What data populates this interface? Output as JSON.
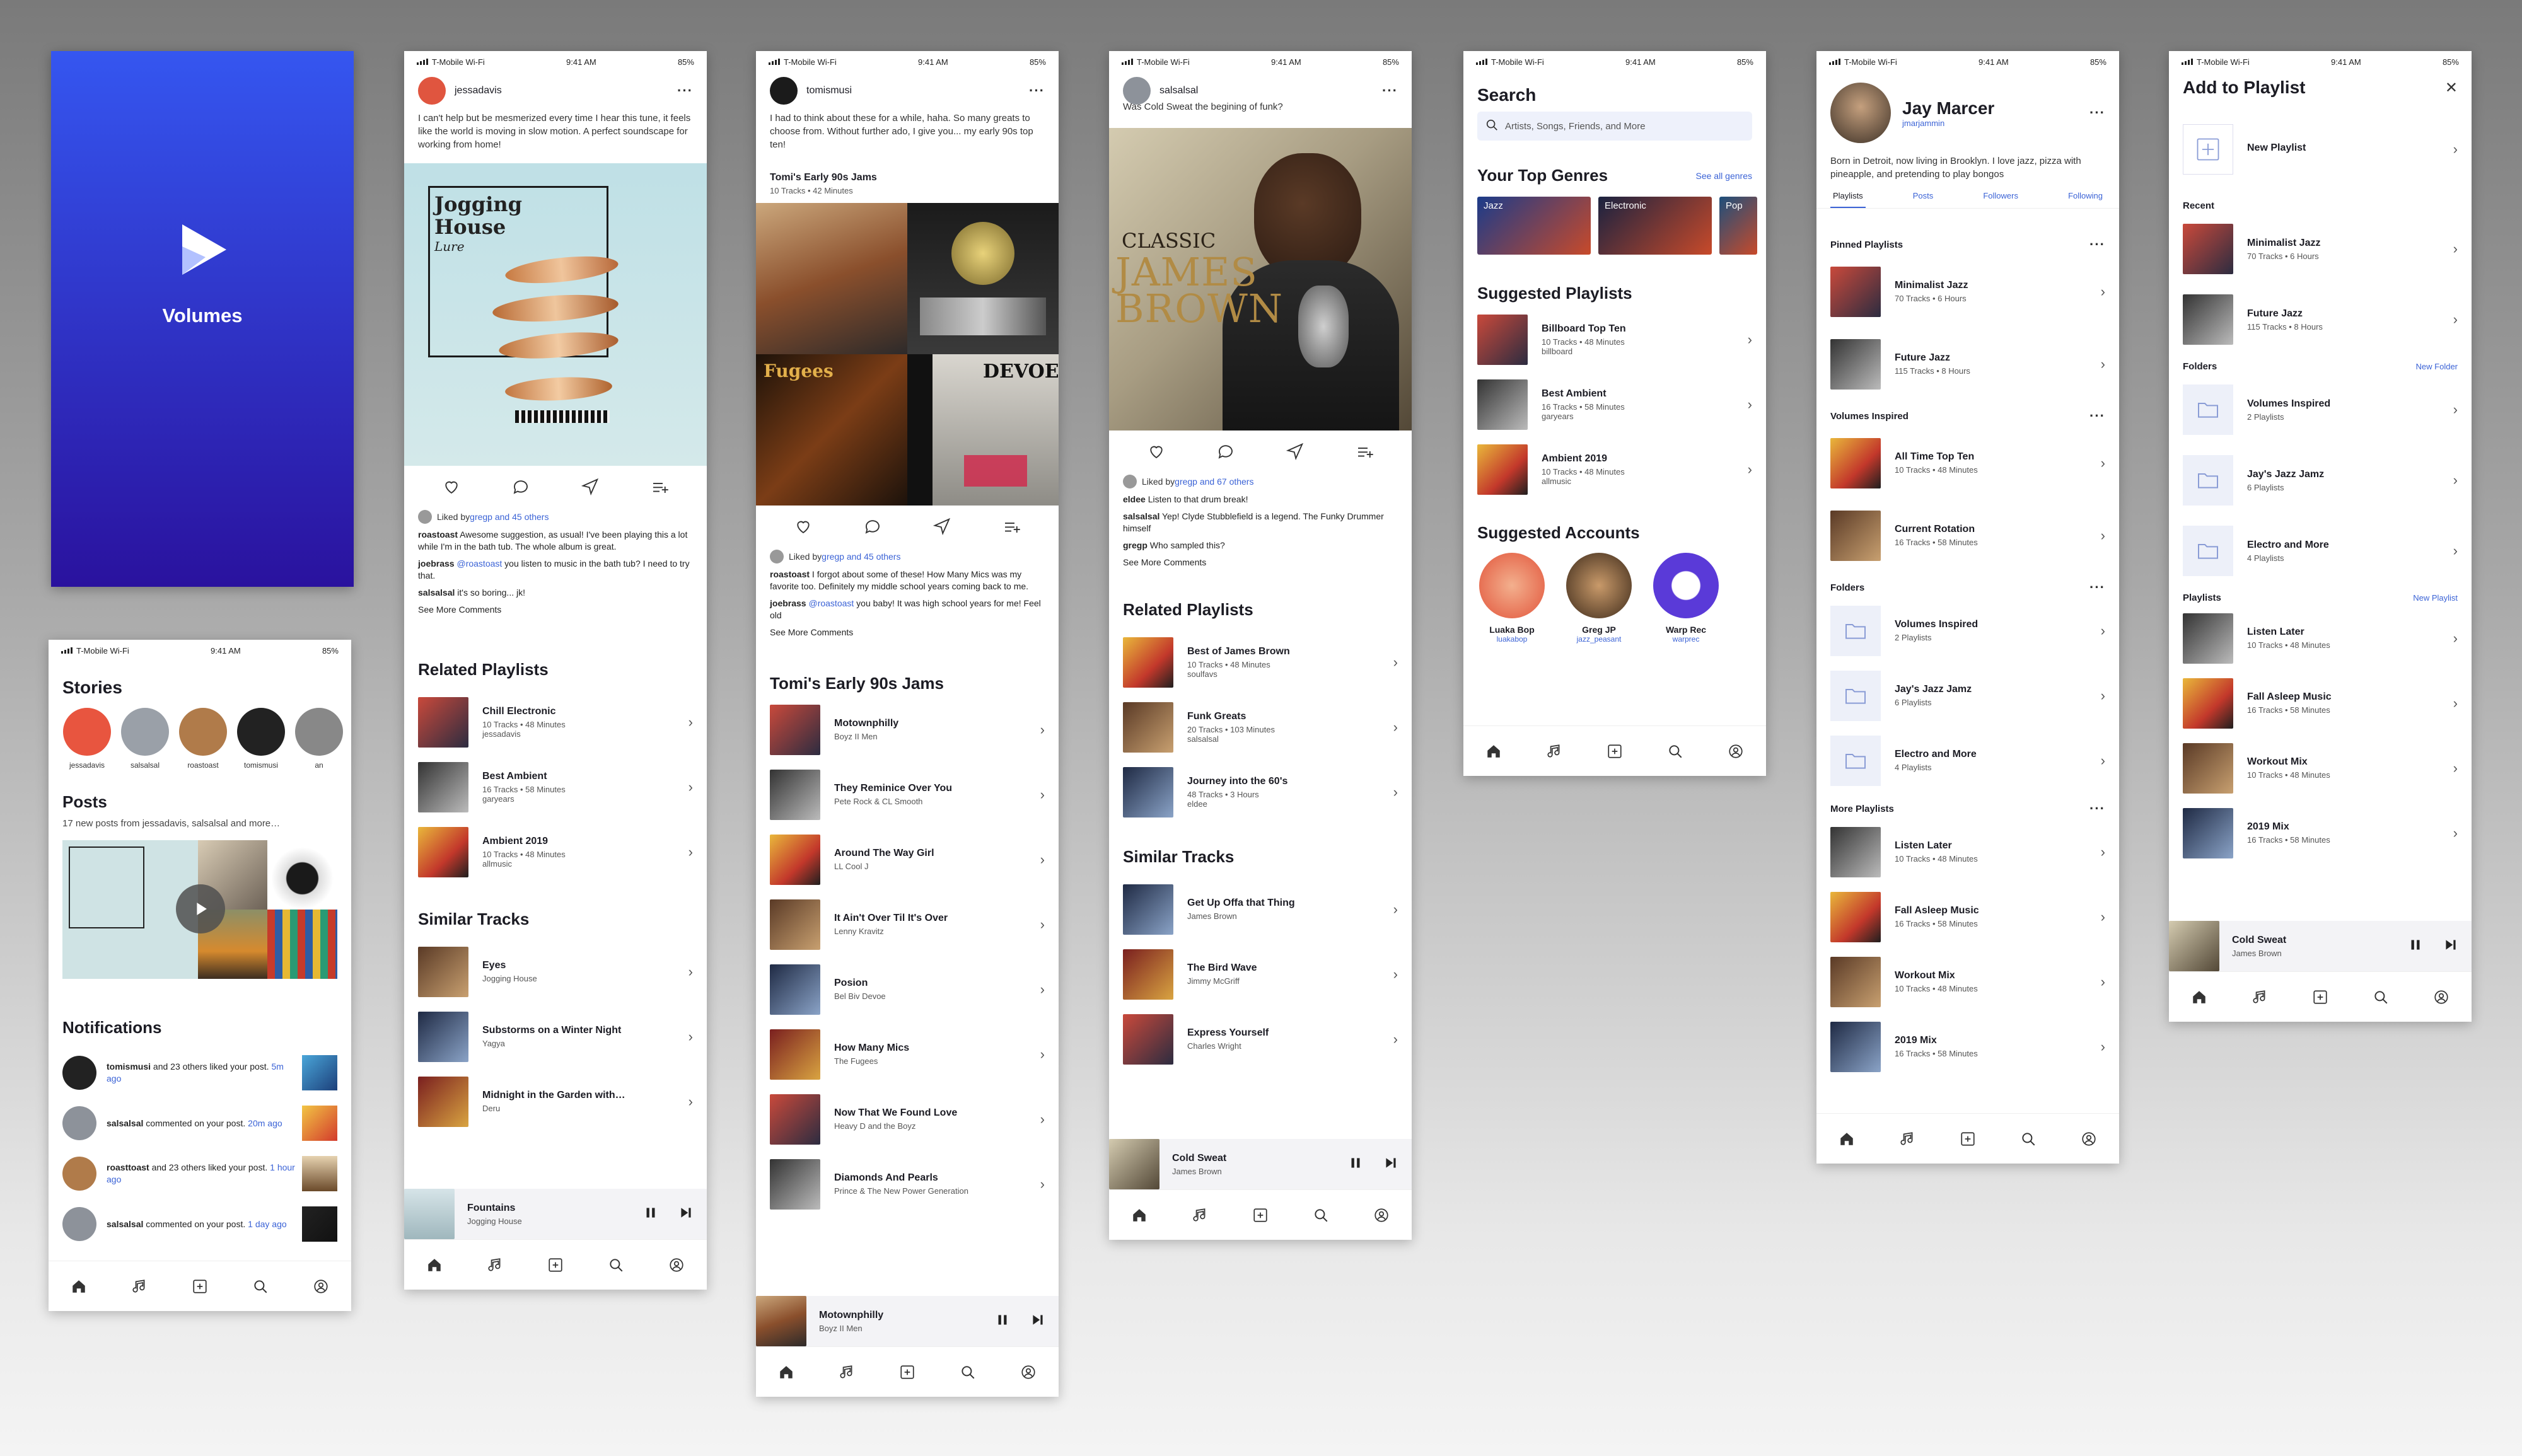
{
  "status": {
    "carrier": "T-Mobile Wi-Fi",
    "time": "9:41 AM",
    "battery": "85%"
  },
  "splash": {
    "app_name": "Volumes"
  },
  "home": {
    "stories_title": "Stories",
    "stories": [
      {
        "name": "jessadavis",
        "color": "#e8553f"
      },
      {
        "name": "salsalsal",
        "color": "#9aa0a8"
      },
      {
        "name": "roastoast",
        "color": "#b07b4a"
      },
      {
        "name": "tomismusi",
        "color": "#222"
      },
      {
        "name": "an",
        "color": "#888"
      }
    ],
    "posts_title": "Posts",
    "posts_sub": "17 new posts from jessadavis, salsalsal and more…",
    "notifications_title": "Notifications",
    "notifications": [
      {
        "user": "tomismusi",
        "text": " and 23 others liked your post.",
        "time": "5m ago"
      },
      {
        "user": "salsalsal",
        "text": " commented on your post.",
        "time": "20m ago"
      },
      {
        "user": "roasttoast",
        "text": " and 23 others liked your post.",
        "time": "1 hour ago"
      },
      {
        "user": "salsalsal",
        "text": " commented on your post.",
        "time": "1 day ago"
      }
    ]
  },
  "post1": {
    "user": "jessadavis",
    "text": "I can't help but be mesmerized every time I hear this tune, it feels like the world is moving in slow motion. A perfect soundscape for working from home!",
    "album_title_line1": "Jogging",
    "album_title_line2": "House",
    "album_subtitle": "Lure",
    "liked_prefix": "Liked by ",
    "liked_link": "gregp and 45 others",
    "comments": [
      {
        "user": "roastoast",
        "text": " Awesome suggestion, as usual! I've been playing this a lot while I'm in the bath tub. The whole album is great."
      },
      {
        "user": "joebrass",
        "mention": " @roastoast",
        "text": " you listen to music in the bath tub? I need to try that."
      },
      {
        "user": "salsalsal",
        "text": " it's so boring... jk!"
      }
    ],
    "see_more": "See More Comments",
    "related_title": "Related Playlists",
    "related": [
      {
        "title": "Chill Electronic",
        "meta": "10 Tracks • 48 Minutes",
        "owner": "jessadavis"
      },
      {
        "title": "Best Ambient",
        "meta": "16 Tracks • 58 Minutes",
        "owner": "garyears"
      },
      {
        "title": "Ambient 2019",
        "meta": "10 Tracks • 48 Minutes",
        "owner": "allmusic"
      }
    ],
    "similar_title": "Similar Tracks",
    "similar": [
      {
        "title": "Eyes",
        "artist": "Jogging House"
      },
      {
        "title": "Substorms on a Winter Night",
        "artist": "Yagya"
      },
      {
        "title": "Midnight in the Garden with…",
        "artist": "Deru"
      }
    ],
    "now_playing": {
      "title": "Fountains",
      "artist": "Jogging House"
    }
  },
  "post2": {
    "user": "tomismusi",
    "text": "I had to think about these for a while, haha. So many greats to choose from. Without further ado, I give you... my early 90s top ten!",
    "playlist_title": "Tomi's Early 90s Jams",
    "playlist_meta": "10 Tracks • 42 Minutes",
    "liked_prefix": "Liked by ",
    "liked_link": "gregp and 45 others",
    "comments": [
      {
        "user": "roastoast",
        "text": " I forgot about some of these! How Many Mics was my favorite too. Definitely my middle school years coming back to me."
      },
      {
        "user": "joebrass",
        "mention": " @roastoast",
        "text": " you baby! It was high school years for me! Feel old"
      }
    ],
    "see_more": "See More Comments",
    "list_title": "Tomi's Early 90s Jams",
    "tracks": [
      {
        "title": "Motownphilly",
        "artist": "Boyz II Men"
      },
      {
        "title": "They Reminice Over You",
        "artist": "Pete Rock & CL Smooth"
      },
      {
        "title": "Around The Way Girl",
        "artist": "LL Cool J"
      },
      {
        "title": "It Ain't Over Til It's Over",
        "artist": "Lenny Kravitz"
      },
      {
        "title": "Posion",
        "artist": "Bel Biv Devoe"
      },
      {
        "title": "How Many Mics",
        "artist": "The Fugees"
      },
      {
        "title": "Now That We Found Love",
        "artist": "Heavy D and the Boyz"
      },
      {
        "title": "Diamonds And Pearls",
        "artist": "Prince & The New Power Generation"
      }
    ],
    "now_playing": {
      "title": "Motownphilly",
      "artist": "Boyz II Men"
    }
  },
  "post3": {
    "user": "salsalsal",
    "text": "Was Cold Sweat the begining of funk?",
    "cover_line1": "CLASSIC",
    "cover_line2": "JAMES",
    "cover_line3": "BROWN",
    "liked_prefix": "Liked by ",
    "liked_link": "gregp and 67 others",
    "comments": [
      {
        "user": "eldee",
        "text": " Listen to that drum break!"
      },
      {
        "user": "salsalsal",
        "text": " Yep! Clyde Stubblefield is a legend. The Funky Drummer himself"
      },
      {
        "user": "gregp",
        "text": " Who sampled this?"
      }
    ],
    "see_more": "See More Comments",
    "related_title": "Related Playlists",
    "related": [
      {
        "title": "Best of James Brown",
        "meta": "10 Tracks • 48 Minutes",
        "owner": "soulfavs"
      },
      {
        "title": "Funk Greats",
        "meta": "20 Tracks • 103 Minutes",
        "owner": "salsalsal"
      },
      {
        "title": "Journey into the 60's",
        "meta": "48 Tracks • 3 Hours",
        "owner": "eldee"
      }
    ],
    "similar_title": "Similar Tracks",
    "similar": [
      {
        "title": "Get Up Offa that Thing",
        "artist": "James Brown"
      },
      {
        "title": "The Bird Wave",
        "artist": "Jimmy McGriff"
      },
      {
        "title": "Express Yourself",
        "artist": "Charles Wright"
      }
    ],
    "now_playing": {
      "title": "Cold Sweat",
      "artist": "James Brown"
    }
  },
  "search": {
    "title": "Search",
    "placeholder": "Artists, Songs, Friends, and More",
    "genres_title": "Your Top Genres",
    "see_all": "See all genres",
    "genres": [
      {
        "name": "Jazz",
        "color": "#1b3b8a"
      },
      {
        "name": "Electronic",
        "color": "#1a2240"
      },
      {
        "name": "Pop",
        "color": "#1d4f7c"
      }
    ],
    "suggested_title": "Suggested Playlists",
    "suggested": [
      {
        "title": "Billboard Top Ten",
        "meta": "10 Tracks • 48 Minutes",
        "owner": "billboard"
      },
      {
        "title": "Best Ambient",
        "meta": "16 Tracks • 58 Minutes",
        "owner": "garyears"
      },
      {
        "title": "Ambient 2019",
        "meta": "10 Tracks • 48 Minutes",
        "owner": "allmusic"
      }
    ],
    "accounts_title": "Suggested Accounts",
    "accounts": [
      {
        "name": "Luaka Bop",
        "handle": "luakabop"
      },
      {
        "name": "Greg JP",
        "handle": "jazz_peasant"
      },
      {
        "name": "Warp Rec",
        "handle": "warprec"
      }
    ]
  },
  "profile": {
    "name": "Jay Marcer",
    "handle": "jmarjammin",
    "bio": "Born in Detroit, now living in Brooklyn. I love jazz, pizza with pineapple, and pretending to play bongos",
    "tabs": [
      "Playlists",
      "Posts",
      "Followers",
      "Following"
    ],
    "pinned_title": "Pinned Playlists",
    "pinned": [
      {
        "title": "Minimalist Jazz",
        "meta": "70 Tracks • 6 Hours"
      },
      {
        "title": "Future Jazz",
        "meta": "115 Tracks • 8 Hours"
      }
    ],
    "vi_title": "Volumes Inspired",
    "vi": [
      {
        "title": "All Time Top Ten",
        "meta": "10 Tracks • 48 Minutes"
      },
      {
        "title": "Current Rotation",
        "meta": "16 Tracks • 58 Minutes"
      }
    ],
    "folders_title": "Folders",
    "folders": [
      {
        "title": "Volumes Inspired",
        "meta": "2 Playlists"
      },
      {
        "title": "Jay's Jazz Jamz",
        "meta": "6 Playlists"
      },
      {
        "title": "Electro and More",
        "meta": "4 Playlists"
      }
    ],
    "more_title": "More Playlists",
    "more": [
      {
        "title": "Listen Later",
        "meta": "10 Tracks • 48 Minutes"
      },
      {
        "title": "Fall Asleep Music",
        "meta": "16 Tracks • 58 Minutes"
      },
      {
        "title": "Workout Mix",
        "meta": "10 Tracks • 48 Minutes"
      },
      {
        "title": "2019 Mix",
        "meta": "16 Tracks • 58 Minutes"
      }
    ]
  },
  "add": {
    "title": "Add to Playlist",
    "new_playlist": "New Playlist",
    "recent_title": "Recent",
    "recent": [
      {
        "title": "Minimalist Jazz",
        "meta": "70 Tracks • 6 Hours"
      },
      {
        "title": "Future Jazz",
        "meta": "115 Tracks • 8 Hours"
      }
    ],
    "folders_title": "Folders",
    "new_folder": "New Folder",
    "folders": [
      {
        "title": "Volumes Inspired",
        "meta": "2 Playlists"
      },
      {
        "title": "Jay's Jazz Jamz",
        "meta": "6 Playlists"
      },
      {
        "title": "Electro and More",
        "meta": "4 Playlists"
      }
    ],
    "playlists_title": "Playlists",
    "new_playlist_link": "New Playlist",
    "playlists": [
      {
        "title": "Listen Later",
        "meta": "10 Tracks • 48 Minutes"
      },
      {
        "title": "Fall Asleep Music",
        "meta": "16 Tracks • 58 Minutes"
      },
      {
        "title": "Workout Mix",
        "meta": "10 Tracks • 48 Minutes"
      },
      {
        "title": "2019 Mix",
        "meta": "16 Tracks • 58 Minutes"
      }
    ],
    "now_playing": {
      "title": "Cold Sweat",
      "artist": "James Brown"
    }
  },
  "icons": {
    "home": "home-icon",
    "music": "music-note-icon",
    "add": "add-square-icon",
    "search": "search-icon",
    "profile": "profile-icon"
  },
  "colors": {
    "accent": "#3b63d6",
    "splash_top": "#3556f0",
    "splash_bottom": "#2a129e"
  }
}
